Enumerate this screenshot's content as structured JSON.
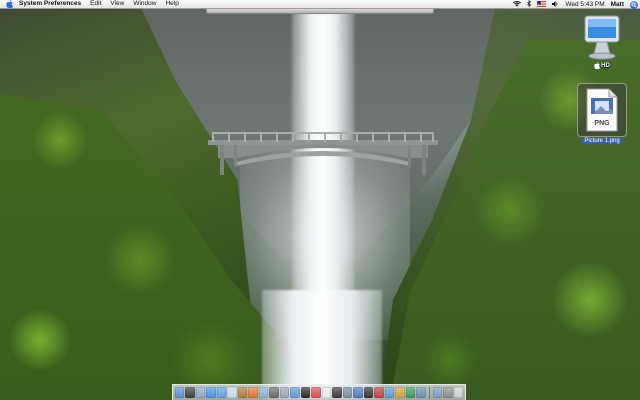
{
  "menubar": {
    "app_name": "System Preferences",
    "menus": [
      "Edit",
      "View",
      "Window",
      "Help"
    ],
    "status": {
      "clock": "Wed 5:43 PM",
      "user": "Matt",
      "icons": [
        "wifi-icon",
        "bluetooth-icon",
        "flag-us-icon",
        "volume-icon",
        "spotlight-icon"
      ]
    }
  },
  "desktop": {
    "wallpaper": "waterfall-bridge",
    "icons": [
      {
        "label": "HD",
        "icon": "hard-drive-icon"
      },
      {
        "label": "Picture 1.png",
        "icon": "png-file-icon",
        "badge": "PNG",
        "selected": true
      }
    ]
  },
  "dock": {
    "items": [
      {
        "name": "finder",
        "color": "#5b8fd6"
      },
      {
        "name": "dashboard",
        "color": "#3b3b3b"
      },
      {
        "name": "mail",
        "color": "#8aa6c8"
      },
      {
        "name": "safari",
        "color": "#4a8fe0"
      },
      {
        "name": "itunes",
        "color": "#5fa0e0"
      },
      {
        "name": "ichat",
        "color": "#c8d8ea"
      },
      {
        "name": "address-book",
        "color": "#b07a3a"
      },
      {
        "name": "firefox",
        "color": "#e0762a"
      },
      {
        "name": "iphoto",
        "color": "#8ab0d0"
      },
      {
        "name": "garageband",
        "color": "#6a6a6a"
      },
      {
        "name": "system-preferences",
        "color": "#9aa4ad"
      },
      {
        "name": "preview",
        "color": "#5b9ad6"
      },
      {
        "name": "terminal",
        "color": "#2a2a2a"
      },
      {
        "name": "ical",
        "color": "#d85050"
      },
      {
        "name": "textedit",
        "color": "#e8e8e8"
      },
      {
        "name": "photo-booth",
        "color": "#3a3a3a"
      },
      {
        "name": "activity-monitor",
        "color": "#7a8a9a"
      },
      {
        "name": "quicktime",
        "color": "#4a7ac0"
      },
      {
        "name": "dvd-player",
        "color": "#333333"
      },
      {
        "name": "app-store",
        "color": "#c04040"
      },
      {
        "name": "keynote",
        "color": "#5a9ad6"
      },
      {
        "name": "pages",
        "color": "#d0a040"
      },
      {
        "name": "numbers",
        "color": "#3a9a5a"
      },
      {
        "name": "xcode",
        "color": "#6a8ab0"
      }
    ],
    "right_items": [
      {
        "name": "downloads",
        "color": "#7a9ac0"
      },
      {
        "name": "applications",
        "color": "#8a8a8a"
      },
      {
        "name": "trash",
        "color": "#c9ced3"
      }
    ]
  }
}
